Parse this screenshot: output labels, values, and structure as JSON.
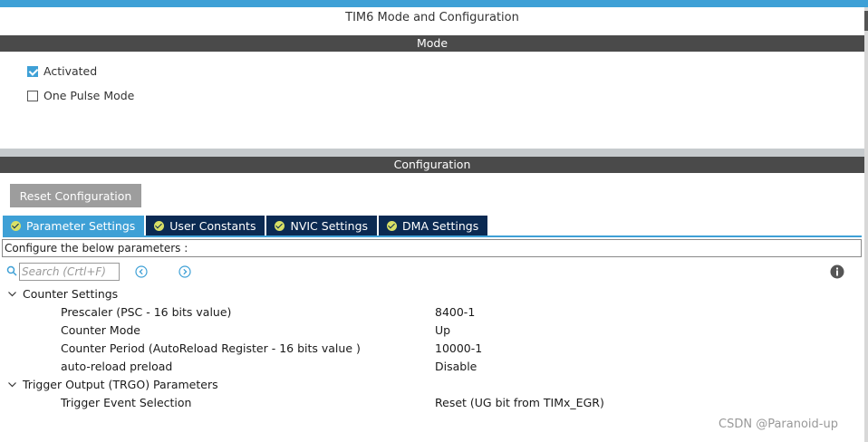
{
  "window": {
    "title": "TIM6 Mode and Configuration"
  },
  "mode": {
    "header": "Mode",
    "options": [
      {
        "label": "Activated",
        "checked": true
      },
      {
        "label": "One Pulse Mode",
        "checked": false
      }
    ]
  },
  "configuration": {
    "header": "Configuration",
    "reset_label": "Reset Configuration",
    "tabs": [
      {
        "label": "Parameter Settings",
        "active": true
      },
      {
        "label": "User Constants",
        "active": false
      },
      {
        "label": "NVIC Settings",
        "active": false
      },
      {
        "label": "DMA Settings",
        "active": false
      }
    ],
    "description": "Configure the below parameters :",
    "search": {
      "placeholder": "Search (Crtl+F)"
    },
    "groups": [
      {
        "name": "Counter Settings",
        "params": [
          {
            "label": "Prescaler (PSC - 16 bits value)",
            "value": "8400-1"
          },
          {
            "label": "Counter Mode",
            "value": "Up"
          },
          {
            "label": "Counter Period (AutoReload Register - 16 bits value )",
            "value": "10000-1"
          },
          {
            "label": "auto-reload preload",
            "value": "Disable"
          }
        ]
      },
      {
        "name": "Trigger Output (TRGO) Parameters",
        "params": [
          {
            "label": "Trigger Event Selection",
            "value": "Reset (UG bit from TIMx_EGR)"
          }
        ]
      }
    ]
  },
  "watermark": "CSDN @Paranoid-up",
  "colors": {
    "accent": "#3ea0d6",
    "tab_inactive": "#0b2a52",
    "header_bg": "#4a4a4a",
    "button_bg": "#9d9d9d"
  },
  "icons": [
    "search-icon",
    "previous-icon",
    "next-icon",
    "info-icon",
    "chevron-down-icon",
    "checkbox-icon",
    "check-circle-icon"
  ]
}
